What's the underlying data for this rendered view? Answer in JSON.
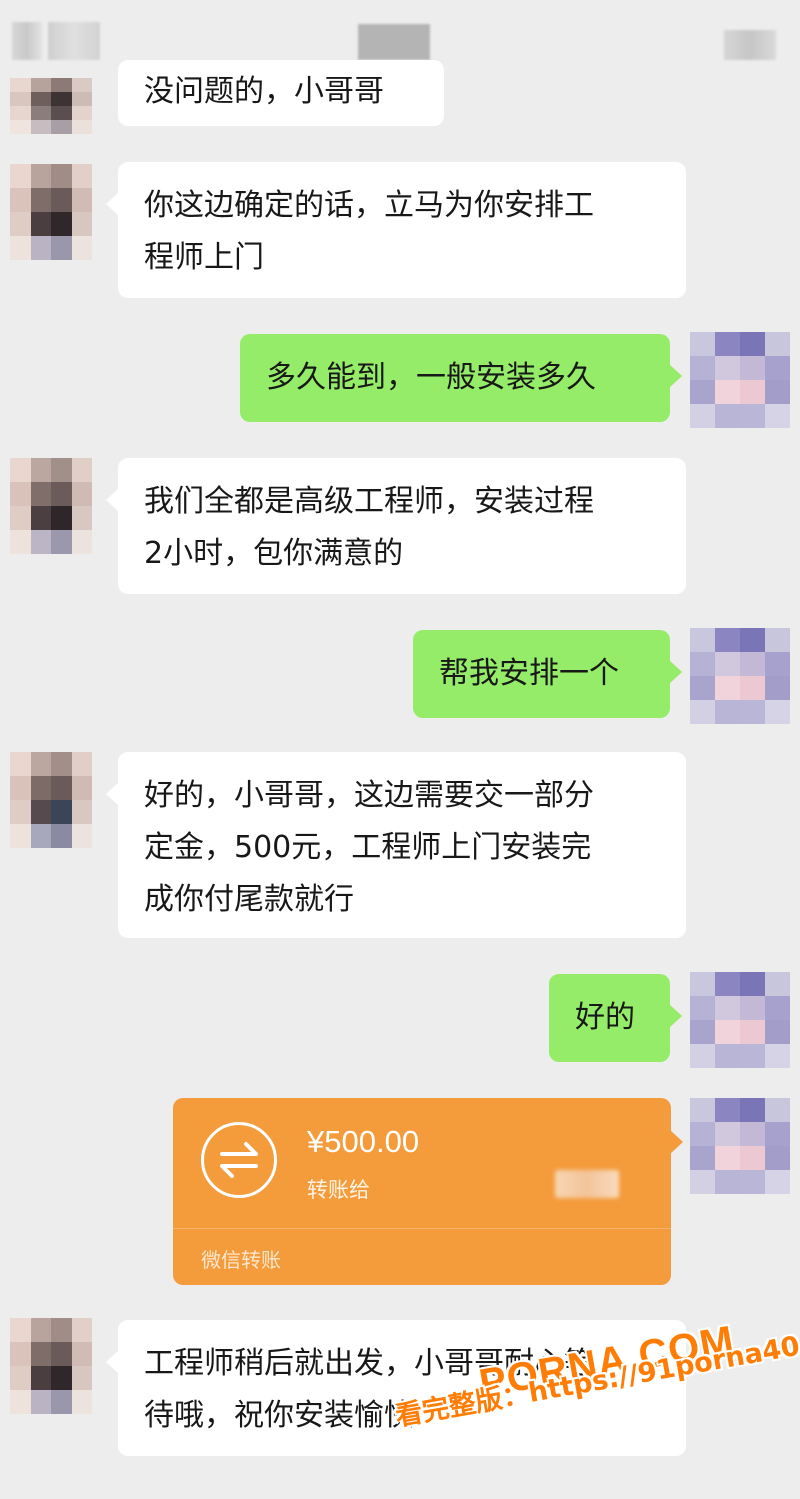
{
  "header": {
    "title_blurred": "",
    "icon_name": "more-icon"
  },
  "messages": [
    {
      "side": "left",
      "text": "没问题的，小哥哥"
    },
    {
      "side": "left",
      "text": "你这边确定的话，立马为你安排工\n程师上门"
    },
    {
      "side": "right",
      "text": "多久能到，一般安装多久"
    },
    {
      "side": "left",
      "text": "我们全都是高级工程师，安装过程\n2小时，包你满意的"
    },
    {
      "side": "right",
      "text": "帮我安排一个"
    },
    {
      "side": "left",
      "text": "好的，小哥哥，这边需要交一部分\n定金，500元，工程师上门安装完\n成你付尾款就行"
    },
    {
      "side": "right",
      "text": "好的"
    },
    {
      "side": "left",
      "text": "工程师稍后就出发，小哥哥耐心等\n待哦，祝你安装愉快"
    }
  ],
  "transfer": {
    "amount": "¥500.00",
    "to_label": "转账给",
    "service_label": "微信转账",
    "icon_name": "transfer-arrows-icon",
    "color": "#f49c3c"
  },
  "watermark": {
    "brand": "PORNA.COM",
    "line2": "看完整版：https://91porna40.com"
  },
  "colors": {
    "background": "#ededed",
    "incoming_bubble": "#ffffff",
    "outgoing_bubble": "#95ec69"
  }
}
